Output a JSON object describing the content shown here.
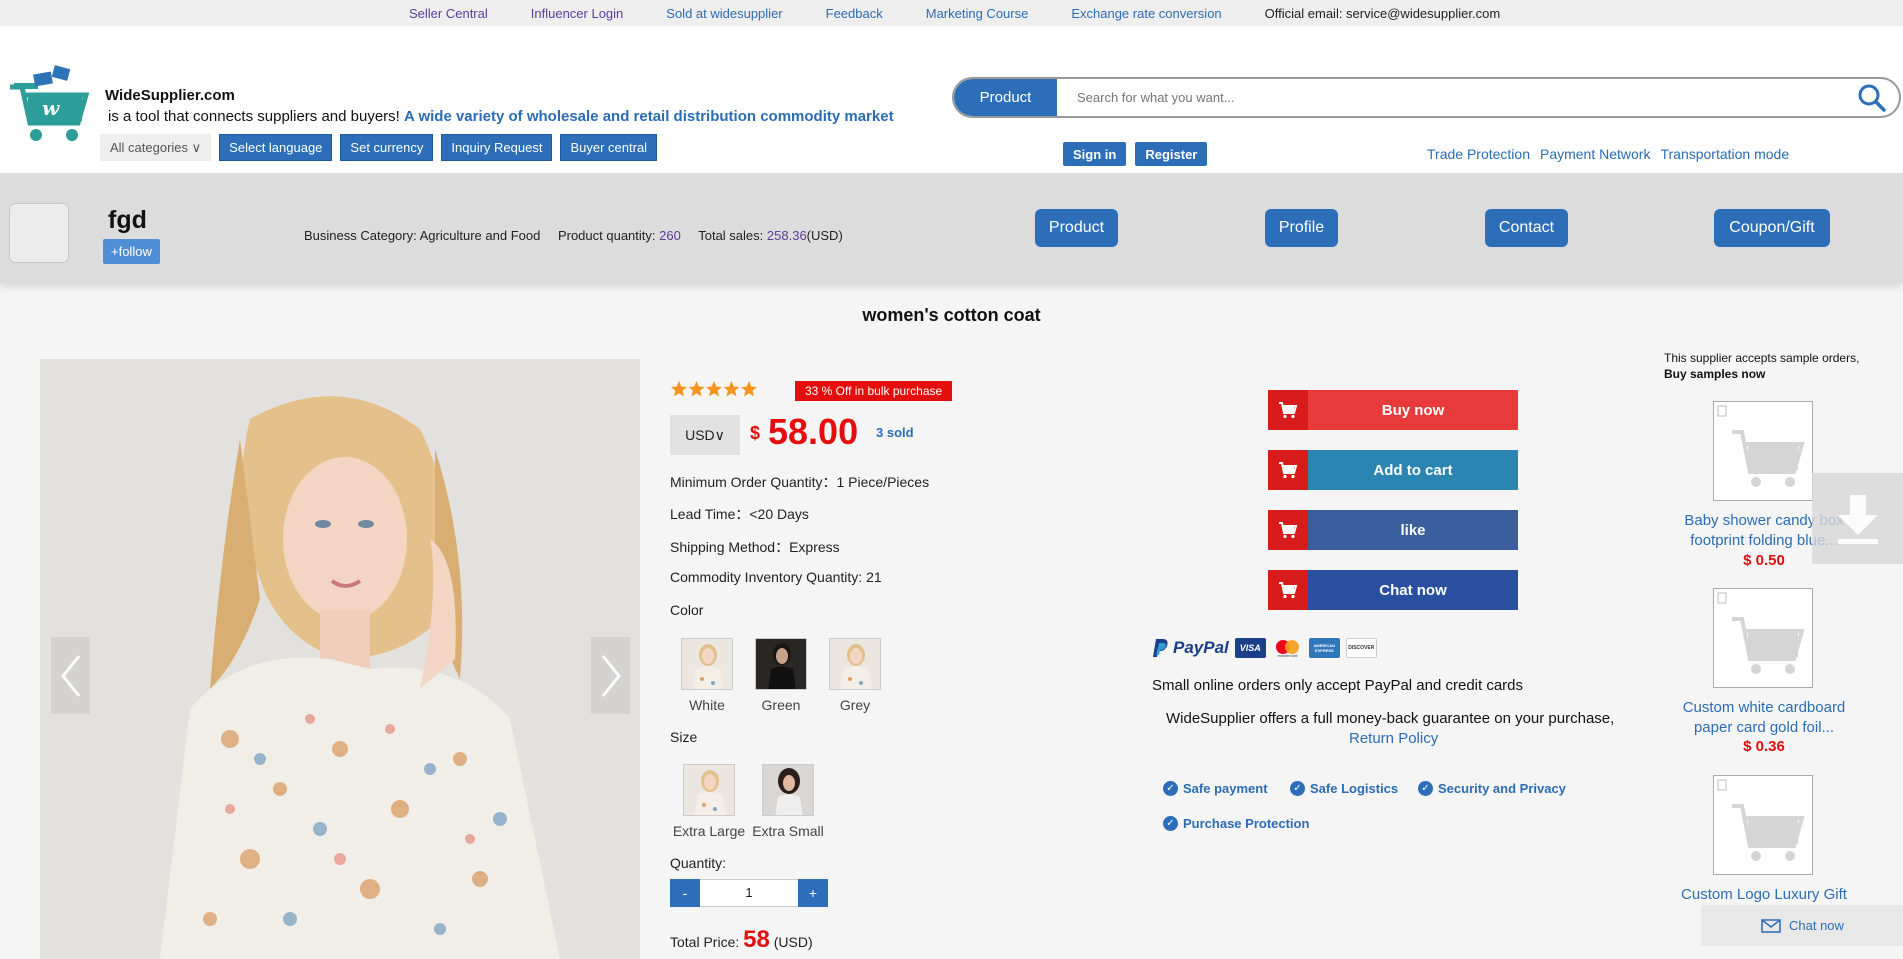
{
  "topbar": {
    "links": [
      "Seller Central",
      "Influencer Login",
      "Sold at widesupplier",
      "Feedback",
      "Marketing Course",
      "Exchange rate conversion"
    ],
    "email": "Official email: service@widesupplier.com"
  },
  "header": {
    "brand": "WideSupplier.com",
    "tagline": "is a tool that connects suppliers and buyers!",
    "tagline_bold": "A wide variety of wholesale and retail distribution commodity market",
    "all_categories": "All categories ∨",
    "buttons": [
      "Select language",
      "Set currency",
      "Inquiry Request",
      "Buyer central"
    ],
    "search_tab": "Product",
    "search_placeholder": "Search for what you want...",
    "sign_in": "Sign in",
    "register": "Register",
    "links": [
      "Trade Protection",
      "Payment Network",
      "Transportation mode"
    ]
  },
  "shop": {
    "name": "fgd",
    "follow": "+follow",
    "category_label": "Business Category:",
    "category": "Agriculture and Food",
    "qty_label": "Product quantity:",
    "qty": "260",
    "sales_label": "Total sales:",
    "sales": "258.36",
    "sales_unit": "(USD)",
    "nav": [
      "Product",
      "Profile",
      "Contact",
      "Coupon/Gift"
    ]
  },
  "product": {
    "title": "women's cotton coat",
    "rating": 5,
    "discount": "33 % Off in bulk purchase",
    "currency": "USD∨",
    "currency_symbol": "$",
    "price": "58.00",
    "sold": "3 sold",
    "moq": "Minimum Order Quantity：1 Piece/Pieces",
    "lead_time": "Lead Time：<20 Days",
    "shipping": "Shipping Method：Express",
    "inventory": "Commodity Inventory Quantity: 21",
    "color_label": "Color",
    "colors": [
      "White",
      "Green",
      "Grey"
    ],
    "size_label": "Size",
    "sizes": [
      "Extra Large",
      "Extra Small"
    ],
    "qty_label": "Quantity:",
    "qty_minus": "-",
    "qty_value": "1",
    "qty_plus": "+",
    "total_label": "Total Price:",
    "total_value": "58",
    "total_unit": "(USD)"
  },
  "actions": [
    {
      "label": "Buy now",
      "color": "#e83a3a"
    },
    {
      "label": "Add to cart",
      "color": "#2a85b0"
    },
    {
      "label": "like",
      "color": "#3b5f9c"
    },
    {
      "label": "Chat now",
      "color": "#2a4f9e"
    }
  ],
  "payment": {
    "badges": [
      "PayPal",
      "VISA",
      "mastercard",
      "AMERICAN EXPRESS",
      "DISCOVER"
    ],
    "note": "Small online orders only accept PayPal and credit cards",
    "guarantee": "WideSupplier offers a full money-back guarantee on your purchase,",
    "return_policy": "Return Policy",
    "features": [
      "Safe payment",
      "Safe Logistics",
      "Security and Privacy",
      "Purchase Protection"
    ]
  },
  "samples": {
    "heading": "This supplier accepts sample orders,",
    "heading_bold": "Buy samples now",
    "items": [
      {
        "name": "Baby shower candy box footprint folding blue...",
        "price": "$ 0.50"
      },
      {
        "name": "Custom white cardboard paper card gold foil...",
        "price": "$ 0.36"
      },
      {
        "name": "Custom Logo Luxury Gift Emp...",
        "price": ""
      }
    ]
  },
  "chat_widget": "Chat now",
  "colors": {
    "brand_blue": "#2c6fb8",
    "red": "#e50e0e",
    "star": "#f7941d"
  }
}
